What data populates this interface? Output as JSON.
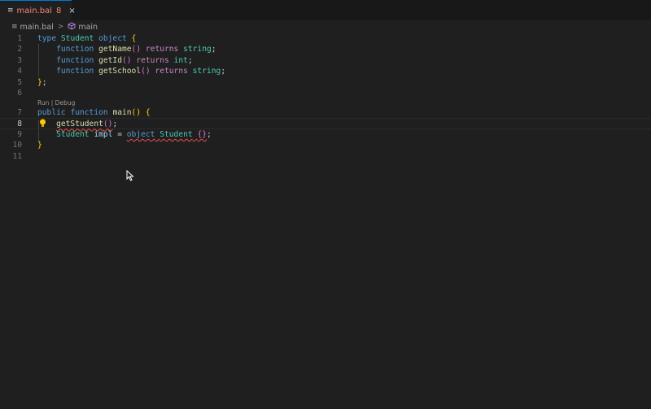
{
  "tab": {
    "icon": "file-lines-icon",
    "label": "main.bal",
    "problem_count": "8",
    "close_glyph": "×"
  },
  "breadcrumb": {
    "file": "main.bal",
    "separator": ">",
    "symbol_icon": "cube-icon",
    "symbol": "main"
  },
  "codelens": "Run | Debug",
  "line_numbers": [
    "1",
    "2",
    "3",
    "4",
    "5",
    "6",
    "7",
    "8",
    "9",
    "10",
    "11"
  ],
  "code": {
    "l1": {
      "kw": "type",
      "ty": "Student",
      "kw2": "object",
      "br": "{"
    },
    "l2": {
      "kw": "function",
      "fn": "getName",
      "paren": "()",
      "kw2": "returns",
      "ty": "string",
      "semi": ";"
    },
    "l3": {
      "kw": "function",
      "fn": "getId",
      "paren": "()",
      "kw2": "returns",
      "ty": "int",
      "semi": ";"
    },
    "l4": {
      "kw": "function",
      "fn": "getSchool",
      "paren": "()",
      "kw2": "returns",
      "ty": "string",
      "semi": ";"
    },
    "l5": {
      "br": "}",
      "semi": ";"
    },
    "l7": {
      "kw": "public",
      "kw2": "function",
      "fn": "main",
      "paren": "()",
      "br": "{"
    },
    "l8": {
      "fn": "getStudent",
      "paren": "()",
      "semi": ";"
    },
    "l9": {
      "ty": "Student",
      "var": "impl",
      "eq": "=",
      "kw": "object",
      "ty2": "Student",
      "br": "{}",
      "semi": ";"
    },
    "l10": {
      "br": "}"
    }
  },
  "colors": {
    "keyword": "#569cd6",
    "control_keyword": "#c586c0",
    "type": "#4ec9b0",
    "function": "#dcdcaa",
    "error": "#f48771"
  },
  "lightbulb_icon": "lightbulb-icon",
  "cursor_icon": "mouse-pointer-icon"
}
